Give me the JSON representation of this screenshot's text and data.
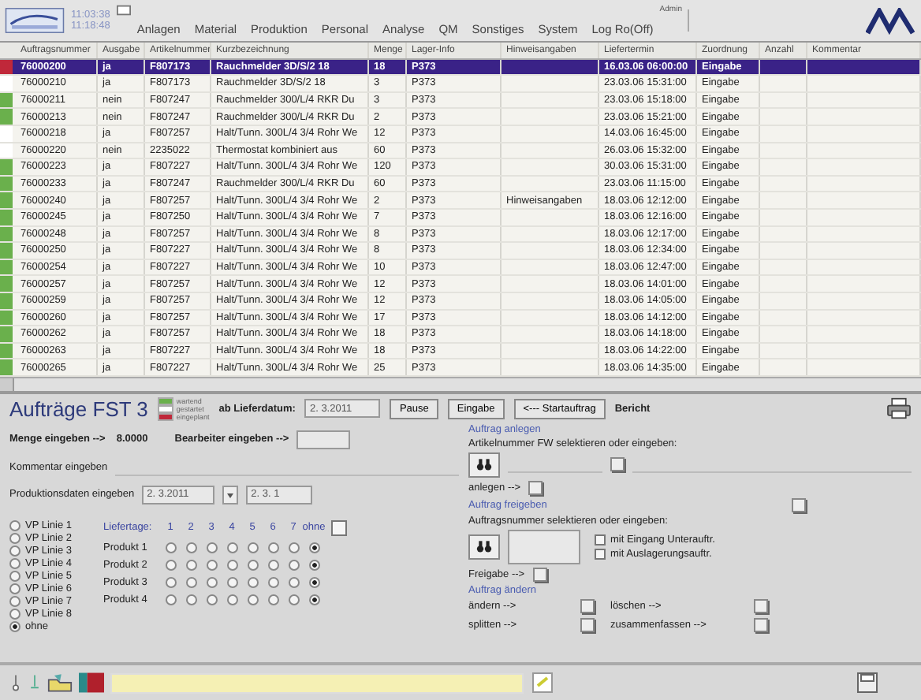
{
  "header": {
    "clock_1": "11:03:38",
    "clock_2": "11:18:48",
    "menu": [
      "Anlagen",
      "Material",
      "Produktion",
      "Personal",
      "Analyse",
      "QM",
      "Sonstiges",
      "System",
      "Log Ro(Off)"
    ],
    "user": "Admin"
  },
  "table": {
    "columns": [
      "Auftragsnummer",
      "Ausgabe",
      "Artikelnummer",
      "Kurzbezeichnung",
      "Menge",
      "Lager-Info",
      "Hinweisangaben",
      "Liefertermin",
      "Zuordnung",
      "Anzahl",
      "Kommentar"
    ],
    "rows": [
      {
        "color": "#c0283a",
        "selected": true,
        "nr": "76000200",
        "ausgabe": "ja",
        "artikel": "F807173",
        "text": "Rauchmelder 3D/S/2 18",
        "menge": "18",
        "lager": "P373",
        "termin": "16.03.06 06:00:00",
        "zuordnung": "Eingabe"
      },
      {
        "color": "#ffffff",
        "selected": false,
        "nr": "76000210",
        "ausgabe": "ja",
        "artikel": "F807173",
        "text": "Rauchmelder 3D/S/2 18",
        "menge": "3",
        "lager": "P373",
        "termin": "23.03.06 15:31:00",
        "zuordnung": "Eingabe"
      },
      {
        "color": "#6ab04c",
        "selected": false,
        "nr": "76000211",
        "ausgabe": "nein",
        "artikel": "F807247",
        "text": "Rauchmelder 300/L/4 RKR Du",
        "menge": "3",
        "lager": "P373",
        "termin": "23.03.06 15:18:00",
        "zuordnung": "Eingabe"
      },
      {
        "color": "#6ab04c",
        "selected": false,
        "nr": "76000213",
        "ausgabe": "nein",
        "artikel": "F807247",
        "text": "Rauchmelder 300/L/4 RKR Du",
        "menge": "2",
        "lager": "P373",
        "termin": "23.03.06 15:21:00",
        "zuordnung": "Eingabe"
      },
      {
        "color": "#ffffff",
        "selected": false,
        "nr": "76000218",
        "ausgabe": "ja",
        "artikel": "F807257",
        "text": "Halt/Tunn. 300L/4 3/4 Rohr We",
        "menge": "12",
        "lager": "P373",
        "termin": "14.03.06 16:45:00",
        "zuordnung": "Eingabe"
      },
      {
        "color": "#ffffff",
        "selected": false,
        "nr": "76000220",
        "ausgabe": "nein",
        "artikel": "2235022",
        "text": "Thermostat kombiniert aus",
        "menge": "60",
        "lager": "P373",
        "termin": "26.03.06 15:32:00",
        "zuordnung": "Eingabe"
      },
      {
        "color": "#6ab04c",
        "selected": false,
        "nr": "76000223",
        "ausgabe": "ja",
        "artikel": "F807227",
        "text": "Halt/Tunn. 300L/4 3/4 Rohr We",
        "menge": "120",
        "lager": "P373",
        "termin": "30.03.06 15:31:00",
        "zuordnung": "Eingabe"
      },
      {
        "color": "#6ab04c",
        "selected": false,
        "nr": "76000233",
        "ausgabe": "ja",
        "artikel": "F807247",
        "text": "Rauchmelder 300/L/4 RKR Du",
        "menge": "60",
        "lager": "P373",
        "termin": "23.03.06 11:15:00",
        "zuordnung": "Eingabe"
      },
      {
        "color": "#6ab04c",
        "selected": false,
        "nr": "76000240",
        "ausgabe": "ja",
        "artikel": "F807257",
        "text": "Halt/Tunn. 300L/4 3/4 Rohr We",
        "menge": "2",
        "lager": "P373",
        "hinweis": "Hinweisangaben",
        "termin": "18.03.06 12:12:00",
        "zuordnung": "Eingabe"
      },
      {
        "color": "#6ab04c",
        "selected": false,
        "nr": "76000245",
        "ausgabe": "ja",
        "artikel": "F807250",
        "text": "Halt/Tunn. 300L/4 3/4 Rohr We",
        "menge": "7",
        "lager": "P373",
        "termin": "18.03.06 12:16:00",
        "zuordnung": "Eingabe"
      },
      {
        "color": "#6ab04c",
        "selected": false,
        "nr": "76000248",
        "ausgabe": "ja",
        "artikel": "F807257",
        "text": "Halt/Tunn. 300L/4 3/4 Rohr We",
        "menge": "8",
        "lager": "P373",
        "termin": "18.03.06 12:17:00",
        "zuordnung": "Eingabe"
      },
      {
        "color": "#6ab04c",
        "selected": false,
        "nr": "76000250",
        "ausgabe": "ja",
        "artikel": "F807227",
        "text": "Halt/Tunn. 300L/4 3/4 Rohr We",
        "menge": "8",
        "lager": "P373",
        "termin": "18.03.06 12:34:00",
        "zuordnung": "Eingabe"
      },
      {
        "color": "#6ab04c",
        "selected": false,
        "nr": "76000254",
        "ausgabe": "ja",
        "artikel": "F807227",
        "text": "Halt/Tunn. 300L/4 3/4 Rohr We",
        "menge": "10",
        "lager": "P373",
        "termin": "18.03.06 12:47:00",
        "zuordnung": "Eingabe"
      },
      {
        "color": "#6ab04c",
        "selected": false,
        "nr": "76000257",
        "ausgabe": "ja",
        "artikel": "F807257",
        "text": "Halt/Tunn. 300L/4 3/4 Rohr We",
        "menge": "12",
        "lager": "P373",
        "termin": "18.03.06 14:01:00",
        "zuordnung": "Eingabe"
      },
      {
        "color": "#6ab04c",
        "selected": false,
        "nr": "76000259",
        "ausgabe": "ja",
        "artikel": "F807257",
        "text": "Halt/Tunn. 300L/4 3/4 Rohr We",
        "menge": "12",
        "lager": "P373",
        "termin": "18.03.06 14:05:00",
        "zuordnung": "Eingabe"
      },
      {
        "color": "#6ab04c",
        "selected": false,
        "nr": "76000260",
        "ausgabe": "ja",
        "artikel": "F807257",
        "text": "Halt/Tunn. 300L/4 3/4 Rohr We",
        "menge": "17",
        "lager": "P373",
        "termin": "18.03.06 14:12:00",
        "zuordnung": "Eingabe"
      },
      {
        "color": "#6ab04c",
        "selected": false,
        "nr": "76000262",
        "ausgabe": "ja",
        "artikel": "F807257",
        "text": "Halt/Tunn. 300L/4 3/4 Rohr We",
        "menge": "18",
        "lager": "P373",
        "termin": "18.03.06 14:18:00",
        "zuordnung": "Eingabe"
      },
      {
        "color": "#6ab04c",
        "selected": false,
        "nr": "76000263",
        "ausgabe": "ja",
        "artikel": "F807227",
        "text": "Halt/Tunn. 300L/4 3/4 Rohr We",
        "menge": "18",
        "lager": "P373",
        "termin": "18.03.06 14:22:00",
        "zuordnung": "Eingabe"
      },
      {
        "color": "#6ab04c",
        "selected": false,
        "nr": "76000265",
        "ausgabe": "ja",
        "artikel": "F807227",
        "text": "Halt/Tunn. 300L/4 3/4 Rohr We",
        "menge": "25",
        "lager": "P373",
        "termin": "18.03.06 14:35:00",
        "zuordnung": "Eingabe"
      }
    ]
  },
  "form": {
    "title": "Aufträge FST 3",
    "legend": [
      {
        "label": "wartend",
        "color": "#6ab04c"
      },
      {
        "label": "gestartet",
        "color": "#ffffff"
      },
      {
        "label": "eingeplant",
        "color": "#c0283a"
      }
    ],
    "date_label": "ab Lieferdatum:",
    "date_value": "2. 3.2011",
    "buttons": [
      "Pause",
      "Eingabe",
      "<--- Startauftrag"
    ],
    "report": "Bericht",
    "menge_label": "Menge eingeben -->",
    "menge_value": "8.0000",
    "bearbeiter_label": "Bearbeiter eingeben -->",
    "kommentar_label": "Kommentar eingeben",
    "produktion_label": "Produktionsdaten eingeben",
    "produktion_value": "2. 3.2011",
    "produktion_value_2": "2. 3. 1",
    "lines": [
      {
        "label": "VP Linie 1",
        "selected": false
      },
      {
        "label": "VP Linie 2",
        "selected": false
      },
      {
        "label": "VP Linie 3",
        "selected": false
      },
      {
        "label": "VP Linie 4",
        "selected": false
      },
      {
        "label": "VP Linie 5",
        "selected": false
      },
      {
        "label": "VP Linie 6",
        "selected": false
      },
      {
        "label": "VP Linie 7",
        "selected": false
      },
      {
        "label": "VP Linie 8",
        "selected": false
      },
      {
        "label": "ohne",
        "selected": true
      }
    ],
    "days_label": "Liefertage:",
    "days": [
      "1",
      "2",
      "3",
      "4",
      "5",
      "6",
      "7",
      "ohne"
    ],
    "days_ohne_checked": false,
    "products": [
      {
        "label": "Produkt 1",
        "options": [
          {
            "selected": false
          },
          {
            "selected": false
          },
          {
            "selected": false
          },
          {
            "selected": false
          },
          {
            "selected": false
          },
          {
            "selected": false
          },
          {
            "selected": false
          },
          {
            "selected": true
          }
        ]
      },
      {
        "label": "Produkt 2",
        "options": [
          {
            "selected": false
          },
          {
            "selected": false
          },
          {
            "selected": false
          },
          {
            "selected": false
          },
          {
            "selected": false
          },
          {
            "selected": false
          },
          {
            "selected": false
          },
          {
            "selected": true
          }
        ]
      },
      {
        "label": "Produkt 3",
        "options": [
          {
            "selected": false
          },
          {
            "selected": false
          },
          {
            "selected": false
          },
          {
            "selected": false
          },
          {
            "selected": false
          },
          {
            "selected": false
          },
          {
            "selected": false
          },
          {
            "selected": true
          }
        ]
      },
      {
        "label": "Produkt 4",
        "options": [
          {
            "selected": false
          },
          {
            "selected": false
          },
          {
            "selected": false
          },
          {
            "selected": false
          },
          {
            "selected": false
          },
          {
            "selected": false
          },
          {
            "selected": false
          },
          {
            "selected": true
          }
        ]
      }
    ],
    "anlegen": {
      "heading": "Auftrag anlegen",
      "prompt": "Artikelnummer FW selektieren oder eingeben:",
      "action": "anlegen -->"
    },
    "freigeben": {
      "heading": "Auftrag freigeben",
      "prompt": "Auftragsnummer selektieren oder eingeben:",
      "action": "Freigabe -->",
      "options": [
        {
          "label": "mit Eingang Unterauftr.",
          "checked": false
        },
        {
          "label": "mit Auslagerungsauftr.",
          "checked": false
        }
      ]
    },
    "aendern": {
      "heading": "Auftrag ändern",
      "actions": [
        "ändern -->",
        "löschen -->",
        "splitten -->",
        "zusammenfassen -->"
      ]
    }
  }
}
